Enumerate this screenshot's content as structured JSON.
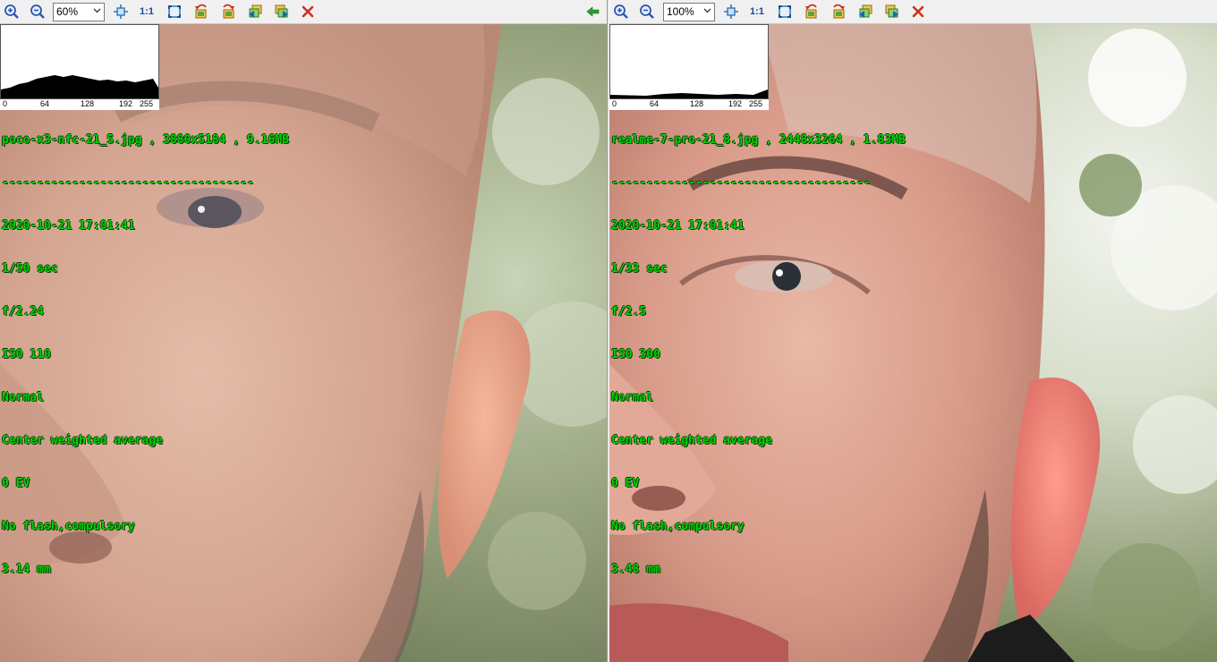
{
  "left": {
    "zoom": "60%",
    "one_to_one": "1:1",
    "histogram_ticks": [
      "0",
      "64",
      "128",
      "192",
      "255"
    ],
    "filename_line": "poco-x3-nfc-21_5.jpg , 3880x5184 , 9.16MB",
    "separator": "------------------------------------",
    "exif": [
      "2020-10-21 17:01:41",
      "1/50 sec",
      "f/2.24",
      "ISO 110",
      "Normal",
      "Center weighted average",
      "0 EV",
      "No flash,compulsory",
      "3.14 mm"
    ]
  },
  "right": {
    "zoom": "100%",
    "one_to_one": "1:1",
    "histogram_ticks": [
      "0",
      "64",
      "128",
      "192",
      "255"
    ],
    "filename_line": "realme-7-pro-21_8.jpg , 2448x3264 , 1.83MB",
    "separator": "-------------------------------------",
    "exif": [
      "2020-10-21 17:01:41",
      "1/33 sec",
      "f/2.5",
      "ISO 300",
      "Normal",
      "Center weighted average",
      "0 EV",
      "No flash,compulsory",
      "3.48 mm"
    ]
  },
  "icons": {
    "zoom_in": "zoom-in-icon",
    "zoom_out": "zoom-out-icon",
    "fit": "fit-window-icon",
    "fullscreen": "fullscreen-icon",
    "rotate_left": "rotate-left-icon",
    "rotate_right": "rotate-right-icon",
    "prev": "previous-image-icon",
    "next": "next-image-icon",
    "close": "close-icon",
    "sync_arrow": "sync-left-arrow-icon"
  },
  "colors": {
    "info_text": "#00d400",
    "close_red": "#d03020"
  }
}
